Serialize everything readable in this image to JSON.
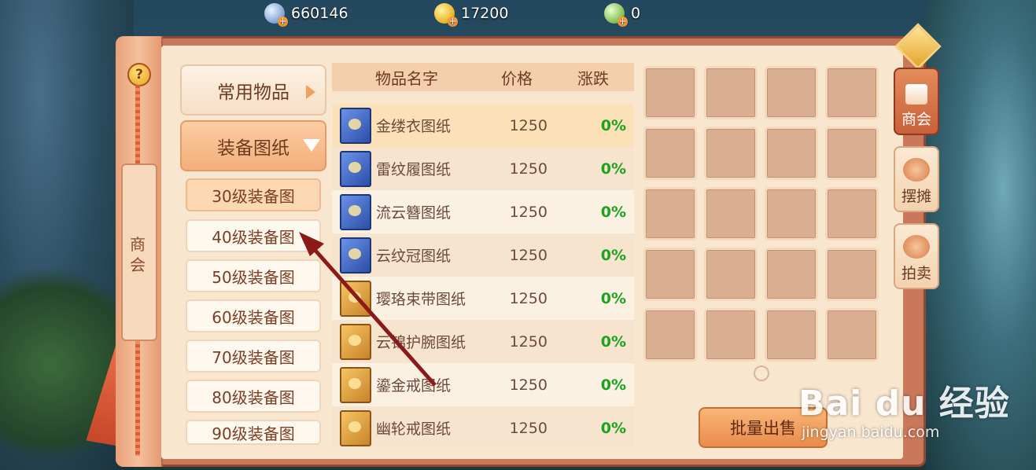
{
  "currencies": [
    {
      "name": "silver-coin-icon",
      "value": "660146"
    },
    {
      "name": "gold-coin-icon",
      "value": "17200"
    },
    {
      "name": "jade-coin-icon",
      "value": "0"
    }
  ],
  "left_strip": {
    "help": "?",
    "tab_label": "商会"
  },
  "categories": {
    "common": "常用物品",
    "equipment": "装备图纸",
    "sub": [
      "30级装备图",
      "40级装备图",
      "50级装备图",
      "60级装备图",
      "70级装备图",
      "80级装备图",
      "90级装备图"
    ]
  },
  "table": {
    "headers": [
      "物品名字",
      "价格",
      "涨跌"
    ],
    "rows": [
      {
        "name": "金缕衣图纸",
        "price": "1250",
        "change": "0%",
        "book": "blue"
      },
      {
        "name": "雷纹履图纸",
        "price": "1250",
        "change": "0%",
        "book": "blue"
      },
      {
        "name": "流云簪图纸",
        "price": "1250",
        "change": "0%",
        "book": "blue"
      },
      {
        "name": "云纹冠图纸",
        "price": "1250",
        "change": "0%",
        "book": "blue"
      },
      {
        "name": "璎珞束带图纸",
        "price": "1250",
        "change": "0%",
        "book": "gold"
      },
      {
        "name": "云锦护腕图纸",
        "price": "1250",
        "change": "0%",
        "book": "gold"
      },
      {
        "name": "鎏金戒图纸",
        "price": "1250",
        "change": "0%",
        "book": "gold"
      },
      {
        "name": "幽轮戒图纸",
        "price": "1250",
        "change": "0%",
        "book": "gold"
      }
    ]
  },
  "bulk_sell": "批量出售",
  "right_tabs": [
    {
      "label": "商会",
      "active": true
    },
    {
      "label": "摆摊",
      "active": false
    },
    {
      "label": "拍卖",
      "active": false
    }
  ],
  "watermark": {
    "brand": "Bai du 经验",
    "url": "jingyan.baidu.com"
  },
  "colors": {
    "change_positive": "#1ea31e",
    "frame": "#c9785a",
    "panel": "#f8e6cf",
    "arrow": "#8b1a1a"
  }
}
